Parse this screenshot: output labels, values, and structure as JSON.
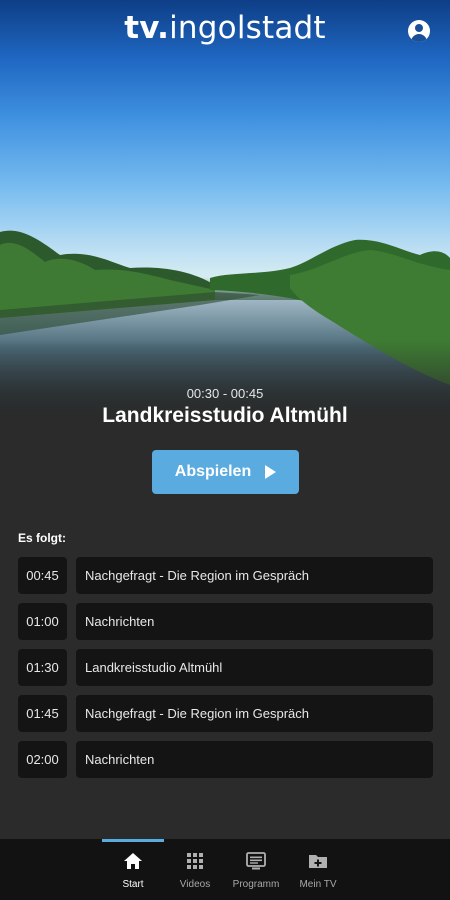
{
  "header": {
    "brand_bold": "tv.",
    "brand_regular": "ingolstadt",
    "account_icon": "account-circle-icon"
  },
  "now_playing": {
    "time": "00:30 - 00:45",
    "title": "Landkreisstudio Altmühl",
    "play_label": "Abspielen"
  },
  "schedule": {
    "heading": "Es folgt:",
    "items": [
      {
        "time": "00:45",
        "title": "Nachgefragt - Die Region im Gespräch"
      },
      {
        "time": "01:00",
        "title": "Nachrichten"
      },
      {
        "time": "01:30",
        "title": "Landkreisstudio Altmühl"
      },
      {
        "time": "01:45",
        "title": "Nachgefragt - Die Region im Gespräch"
      },
      {
        "time": "02:00",
        "title": "Nachrichten"
      }
    ]
  },
  "tabs": [
    {
      "label": "Start",
      "icon": "home-icon",
      "active": true
    },
    {
      "label": "Videos",
      "icon": "grid-icon",
      "active": false
    },
    {
      "label": "Programm",
      "icon": "tv-guide-icon",
      "active": false
    },
    {
      "label": "Mein TV",
      "icon": "folder-add-icon",
      "active": false
    }
  ],
  "colors": {
    "accent": "#5aabe0",
    "background": "#2b2b2b",
    "row_background": "#141414",
    "tabbar_background": "#121212"
  }
}
